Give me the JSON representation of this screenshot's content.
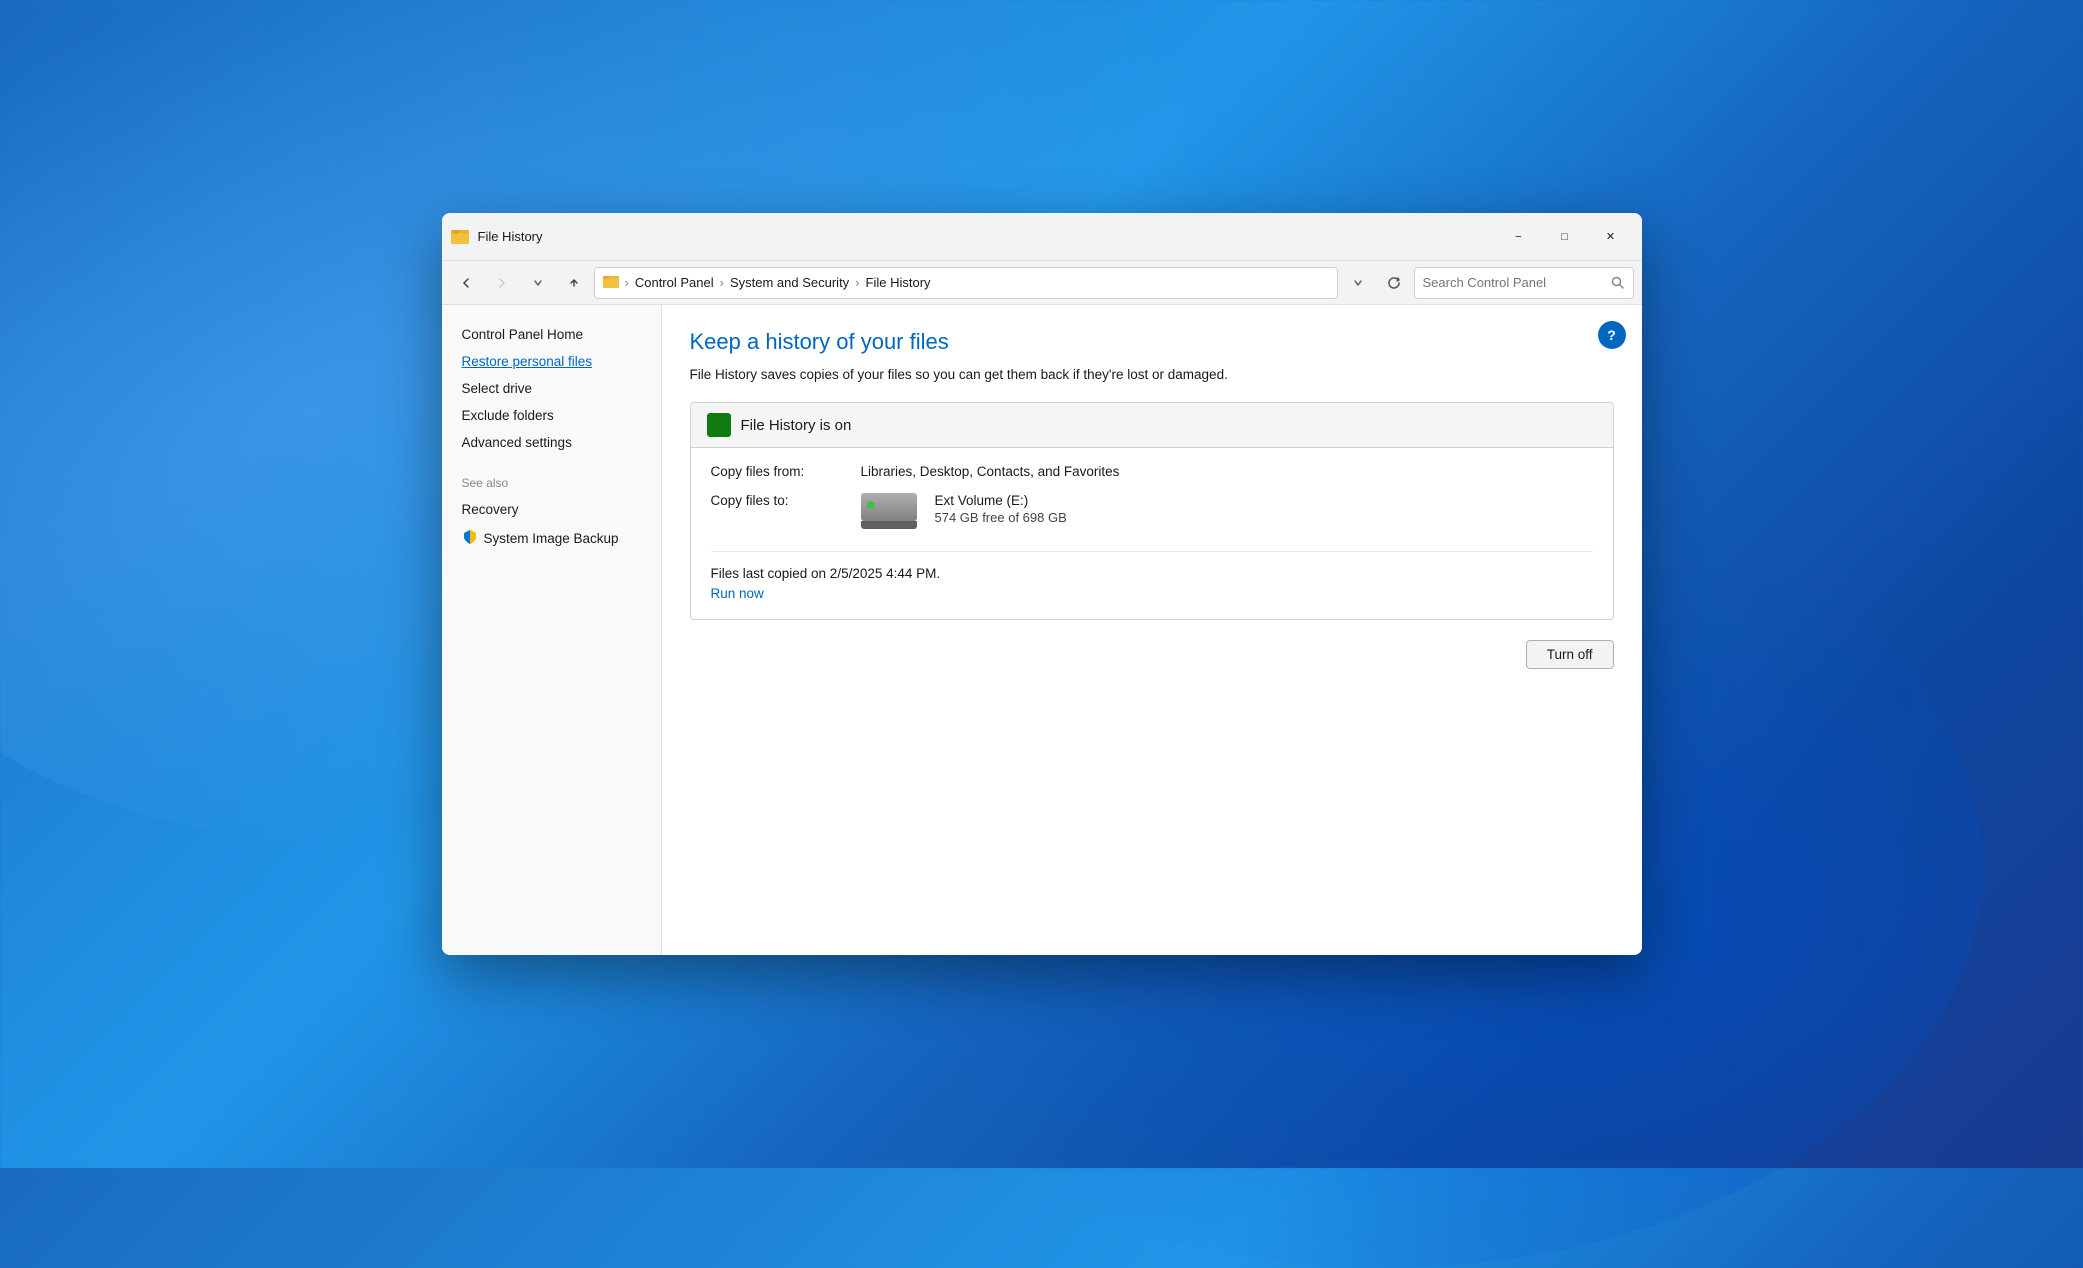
{
  "window": {
    "title": "File History",
    "icon": "📁"
  },
  "title_bar": {
    "minimize_label": "−",
    "maximize_label": "□",
    "close_label": "✕"
  },
  "nav": {
    "back_enabled": true,
    "forward_enabled": false,
    "address": {
      "icon": "🗂",
      "segments": [
        "Control Panel",
        "System and Security",
        "File History"
      ]
    },
    "search_placeholder": "Search Control Panel"
  },
  "sidebar": {
    "items": [
      {
        "id": "control-panel-home",
        "label": "Control Panel Home",
        "active": false
      },
      {
        "id": "restore-personal-files",
        "label": "Restore personal files",
        "active": true
      },
      {
        "id": "select-drive",
        "label": "Select drive",
        "active": false
      },
      {
        "id": "exclude-folders",
        "label": "Exclude folders",
        "active": false
      },
      {
        "id": "advanced-settings",
        "label": "Advanced settings",
        "active": false
      }
    ],
    "see_also_label": "See also",
    "see_also_items": [
      {
        "id": "recovery",
        "label": "Recovery",
        "icon": false
      },
      {
        "id": "system-image-backup",
        "label": "System Image Backup",
        "icon": true
      }
    ]
  },
  "main": {
    "page_title": "Keep a history of your files",
    "page_description": "File History saves copies of your files so you can get them back if they're lost or damaged.",
    "status": {
      "indicator_color": "#107c10",
      "title": "File History is on",
      "copy_files_from_label": "Copy files from:",
      "copy_files_from_value": "Libraries, Desktop, Contacts, and Favorites",
      "copy_files_to_label": "Copy files to:",
      "drive_name": "Ext Volume (E:)",
      "drive_space": "574 GB free of 698 GB",
      "last_copied": "Files last copied on 2/5/2025 4:44 PM.",
      "run_now_label": "Run now"
    },
    "turn_off_label": "Turn off",
    "help_label": "?"
  }
}
